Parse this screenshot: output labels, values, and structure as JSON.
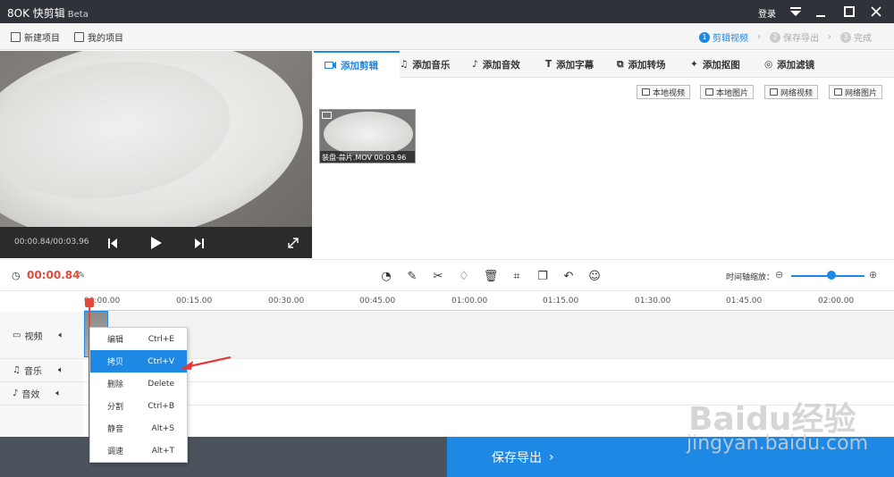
{
  "app": {
    "title": "快剪辑",
    "beta": "Beta",
    "login": "登录"
  },
  "toolbar": {
    "new_project": "新建项目",
    "my_project": "我的项目",
    "steps": [
      {
        "num": "1",
        "label": "剪辑视频"
      },
      {
        "num": "2",
        "label": "保存导出"
      },
      {
        "num": "3",
        "label": "完成"
      }
    ]
  },
  "player": {
    "time": "00:00.84/00:03.96"
  },
  "tabs": [
    "添加剪辑",
    "添加音乐",
    "添加音效",
    "添加字幕",
    "添加转场",
    "添加抠图",
    "添加滤镜"
  ],
  "sources": [
    "本地视频",
    "本地图片",
    "网络视频",
    "网络图片"
  ],
  "clip": {
    "label": "装盘-蒜片.MOV  00:03.96"
  },
  "edit": {
    "current_time": "00:00.84",
    "zoom_label": "时间轴缩放："
  },
  "ruler": [
    "00:00.00",
    "00:15.00",
    "00:30.00",
    "00:45.00",
    "01:00.00",
    "01:15.00",
    "01:30.00",
    "01:45.00",
    "02:00.00"
  ],
  "tracks": {
    "video": "视频",
    "music": "音乐",
    "sfx": "音效"
  },
  "context_menu": [
    {
      "label": "编辑",
      "shortcut": "Ctrl+E"
    },
    {
      "label": "拷贝",
      "shortcut": "Ctrl+V"
    },
    {
      "label": "删除",
      "shortcut": "Delete"
    },
    {
      "label": "分割",
      "shortcut": "Ctrl+B"
    },
    {
      "label": "静音",
      "shortcut": "Alt+S"
    },
    {
      "label": "调速",
      "shortcut": "Alt+T"
    }
  ],
  "export": {
    "label": "保存导出"
  },
  "watermark": {
    "brand": "Baidu经验",
    "url": "jingyan.baidu.com"
  },
  "colors": {
    "accent": "#1e88e5",
    "time_red": "#e24b3b"
  },
  "zoom_level": 0.55
}
